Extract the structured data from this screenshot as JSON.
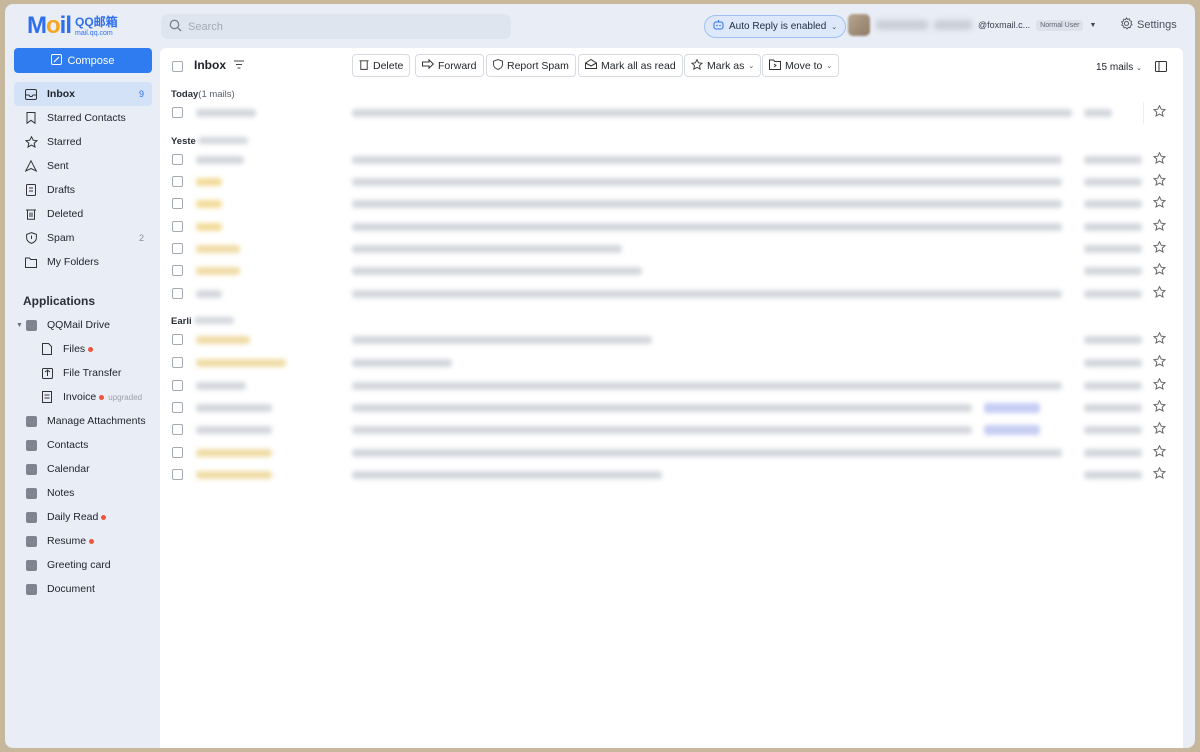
{
  "brand": {
    "logo_text": "Mail",
    "product_cn": "QQ邮箱",
    "url": "mail.qq.com"
  },
  "search": {
    "placeholder": "Search"
  },
  "header": {
    "auto_reply": "Auto Reply is enabled",
    "email_suffix": "@foxmail.c...",
    "user_level": "Normal User",
    "settings": "Settings"
  },
  "sidebar": {
    "compose": "Compose",
    "items": [
      {
        "label": "Inbox",
        "count": "9",
        "icon": "inbox-icon"
      },
      {
        "label": "Starred Contacts",
        "icon": "bookmark-icon"
      },
      {
        "label": "Starred",
        "icon": "star-icon"
      },
      {
        "label": "Sent",
        "icon": "send-icon"
      },
      {
        "label": "Drafts",
        "icon": "draft-icon"
      },
      {
        "label": "Deleted",
        "icon": "trash-icon"
      },
      {
        "label": "Spam",
        "count": "2",
        "icon": "shield-icon"
      },
      {
        "label": "My Folders",
        "icon": "folder-icon"
      }
    ],
    "applications_title": "Applications",
    "apps": [
      {
        "label": "QQMail Drive"
      },
      {
        "label": "Files"
      },
      {
        "label": "File Transfer"
      },
      {
        "label": "Invoice",
        "note": "upgraded"
      },
      {
        "label": "Manage Attachments"
      },
      {
        "label": "Contacts"
      },
      {
        "label": "Calendar"
      },
      {
        "label": "Notes"
      },
      {
        "label": "Daily Read"
      },
      {
        "label": "Resume"
      },
      {
        "label": "Greeting card"
      },
      {
        "label": "Document"
      }
    ]
  },
  "toolbar": {
    "title": "Inbox",
    "delete": "Delete",
    "forward": "Forward",
    "report_spam": "Report Spam",
    "mark_all_read": "Mark all as read",
    "mark_as": "Mark as",
    "move_to": "Move to",
    "mail_count": "15 mails"
  },
  "groups": {
    "today": {
      "label": "Today",
      "count": "(1 mails)"
    },
    "yesterday": {
      "label": "Yeste"
    },
    "earlier": {
      "label": "Earli"
    }
  },
  "colors": {
    "accent": "#2f7bf0",
    "sidebar_bg": "#e9eef6",
    "active_bg": "#d4e2f8",
    "dot": "#f0543b"
  }
}
